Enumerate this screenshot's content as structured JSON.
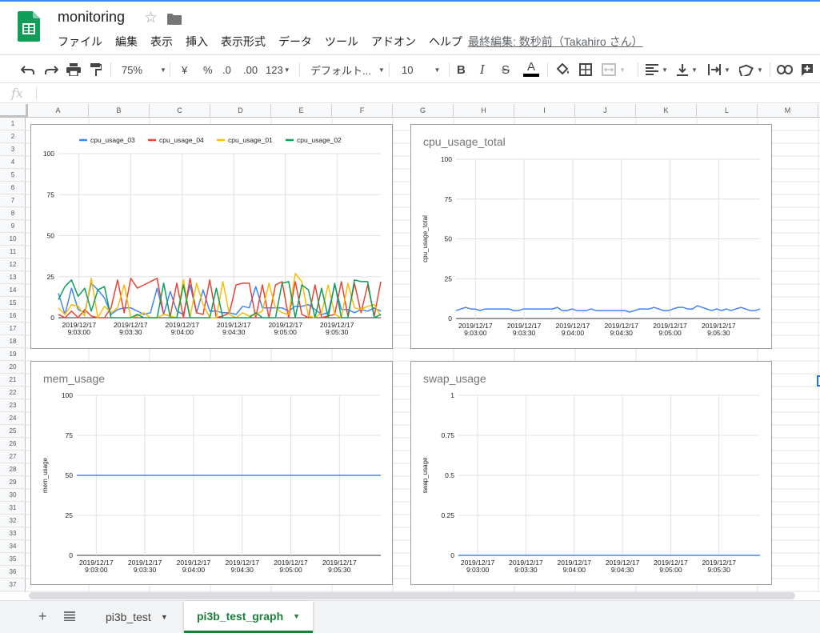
{
  "app": {
    "title": "monitoring",
    "last_edit": "最終編集: 数秒前（Takahiro さん）",
    "accent": "#4285f4",
    "logo_color": "#0f9d58",
    "star_icon": "star-outline",
    "folder_icon": "folder"
  },
  "menu": [
    "ファイル",
    "編集",
    "表示",
    "挿入",
    "表示形式",
    "データ",
    "ツール",
    "アドオン",
    "ヘルプ"
  ],
  "toolbar": {
    "zoom": "75%",
    "currency": "¥",
    "percent": "%",
    "dec_decrease": ".0",
    "dec_increase": ".00",
    "more_formats": "123",
    "font": "デフォルト...",
    "font_size": "10",
    "bold": "B",
    "italic": "I",
    "strike": "S",
    "text_color": "A"
  },
  "formula_bar": {
    "fx": "fx",
    "value": ""
  },
  "columns": [
    "A",
    "B",
    "C",
    "D",
    "E",
    "F",
    "G",
    "H",
    "I",
    "J",
    "K",
    "L",
    "M"
  ],
  "rows": [
    "1",
    "2",
    "3",
    "4",
    "5",
    "6",
    "7",
    "8",
    "9",
    "10",
    "11",
    "12",
    "13",
    "14",
    "15",
    "16",
    "17",
    "18",
    "19",
    "20",
    "21",
    "22",
    "23",
    "24",
    "25",
    "26",
    "27",
    "28",
    "29",
    "30",
    "31",
    "32",
    "33",
    "34",
    "35",
    "36",
    "37"
  ],
  "sheets": {
    "add_icon": "plus",
    "list_icon": "list",
    "tabs": [
      {
        "label": "pi3b_test",
        "active": false
      },
      {
        "label": "pi3b_test_graph",
        "active": true
      }
    ]
  },
  "chart_data": [
    {
      "type": "line",
      "title": "",
      "legend_position": "top",
      "ylim": [
        0,
        100
      ],
      "yticks": [
        "0",
        "25",
        "50",
        "75",
        "100"
      ],
      "xtick_labels": [
        [
          "2019/12/17",
          "9:03:00"
        ],
        [
          "2019/12/17",
          "9:03:30"
        ],
        [
          "2019/12/17",
          "9:04:00"
        ],
        [
          "2019/12/17",
          "9:04:30"
        ],
        [
          "2019/12/17",
          "9:05:00"
        ],
        [
          "2019/12/17",
          "9:05:30"
        ]
      ],
      "series": [
        {
          "name": "cpu_usage_03",
          "color": "#4285f4",
          "values": [
            15,
            2,
            18,
            5,
            3,
            21,
            17,
            12,
            2,
            5,
            6,
            6,
            4,
            2,
            3,
            18,
            2,
            16,
            4,
            2,
            20,
            3,
            17,
            4,
            4,
            3,
            3,
            2,
            7,
            6,
            19,
            6,
            6,
            6,
            6,
            4,
            7,
            7,
            8,
            5,
            2,
            3,
            20,
            5,
            5,
            3,
            5,
            4,
            6,
            4
          ]
        },
        {
          "name": "cpu_usage_04",
          "color": "#ea4335",
          "values": [
            2,
            0,
            4,
            0,
            5,
            1,
            0,
            0,
            6,
            23,
            3,
            24,
            18,
            20,
            22,
            24,
            2,
            1,
            21,
            0,
            24,
            3,
            2,
            23,
            0,
            1,
            3,
            20,
            21,
            21,
            0,
            20,
            0,
            20,
            22,
            0,
            22,
            2,
            0,
            20,
            0,
            1,
            2,
            22,
            1,
            21,
            3,
            20,
            1,
            22
          ]
        },
        {
          "name": "cpu_usage_01",
          "color": "#fbbc05",
          "values": [
            6,
            2,
            8,
            7,
            1,
            24,
            0,
            7,
            3,
            6,
            20,
            0,
            1,
            3,
            0,
            0,
            2,
            1,
            0,
            23,
            0,
            21,
            8,
            0,
            0,
            22,
            2,
            0,
            3,
            1,
            2,
            4,
            21,
            6,
            3,
            2,
            27,
            22,
            1,
            0,
            3,
            20,
            2,
            0,
            21,
            6,
            5,
            7,
            8,
            1
          ]
        },
        {
          "name": "cpu_usage_02",
          "color": "#0f9d58",
          "values": [
            11,
            19,
            23,
            13,
            18,
            4,
            17,
            19,
            0,
            0,
            0,
            0,
            2,
            0,
            0,
            0,
            21,
            0,
            0,
            20,
            0,
            0,
            0,
            0,
            18,
            0,
            0,
            0,
            0,
            0,
            3,
            0,
            0,
            0,
            21,
            22,
            0,
            20,
            17,
            0,
            18,
            0,
            21,
            0,
            0,
            23,
            22,
            22,
            0,
            2
          ]
        }
      ]
    },
    {
      "type": "line",
      "title": "cpu_usage_total",
      "ylabel": "cpu_usage_total",
      "ylim": [
        0,
        100
      ],
      "yticks": [
        "0",
        "25",
        "50",
        "75",
        "100"
      ],
      "xtick_labels": [
        [
          "2019/12/17",
          "9:03:00"
        ],
        [
          "2019/12/17",
          "9:03:30"
        ],
        [
          "2019/12/17",
          "9:04:00"
        ],
        [
          "2019/12/17",
          "9:04:30"
        ],
        [
          "2019/12/17",
          "9:05:00"
        ],
        [
          "2019/12/17",
          "9:05:30"
        ]
      ],
      "series": [
        {
          "name": "cpu_usage_total",
          "color": "#4285f4",
          "values": [
            5,
            6,
            7,
            6,
            6,
            5,
            6,
            6,
            6,
            6,
            6,
            6,
            5,
            5,
            6,
            6,
            6,
            6,
            6,
            6,
            6,
            7,
            5,
            5,
            6,
            5,
            5,
            5,
            6,
            5,
            5,
            5,
            5,
            5,
            5,
            5,
            4,
            5,
            6,
            6,
            6,
            7,
            6,
            5,
            5,
            6,
            7,
            7,
            6,
            6,
            8,
            7,
            6,
            5,
            6,
            5,
            6,
            5,
            6,
            7,
            6,
            5,
            5,
            6
          ]
        }
      ]
    },
    {
      "type": "line",
      "title": "mem_usage",
      "ylabel": "mem_usage",
      "ylim": [
        0,
        100
      ],
      "yticks": [
        "0",
        "25",
        "50",
        "75",
        "100"
      ],
      "xtick_labels": [
        [
          "2019/12/17",
          "9:03:00"
        ],
        [
          "2019/12/17",
          "9:03:30"
        ],
        [
          "2019/12/17",
          "9:04:00"
        ],
        [
          "2019/12/17",
          "9:04:30"
        ],
        [
          "2019/12/17",
          "9:05:00"
        ],
        [
          "2019/12/17",
          "9:05:30"
        ]
      ],
      "series": [
        {
          "name": "mem_usage",
          "color": "#4285f4",
          "values": [
            50,
            50
          ]
        }
      ]
    },
    {
      "type": "line",
      "title": "swap_usage",
      "ylabel": "swap_usage",
      "ylim": [
        0,
        1
      ],
      "yticks": [
        "0",
        "0.25",
        "0.5",
        "0.75",
        "1"
      ],
      "xtick_labels": [
        [
          "2019/12/17",
          "9:03:00"
        ],
        [
          "2019/12/17",
          "9:03:30"
        ],
        [
          "2019/12/17",
          "9:04:00"
        ],
        [
          "2019/12/17",
          "9:04:30"
        ],
        [
          "2019/12/17",
          "9:05:00"
        ],
        [
          "2019/12/17",
          "9:05:30"
        ]
      ],
      "series": [
        {
          "name": "swap_usage",
          "color": "#4285f4",
          "values": [
            0,
            0
          ]
        }
      ]
    }
  ]
}
